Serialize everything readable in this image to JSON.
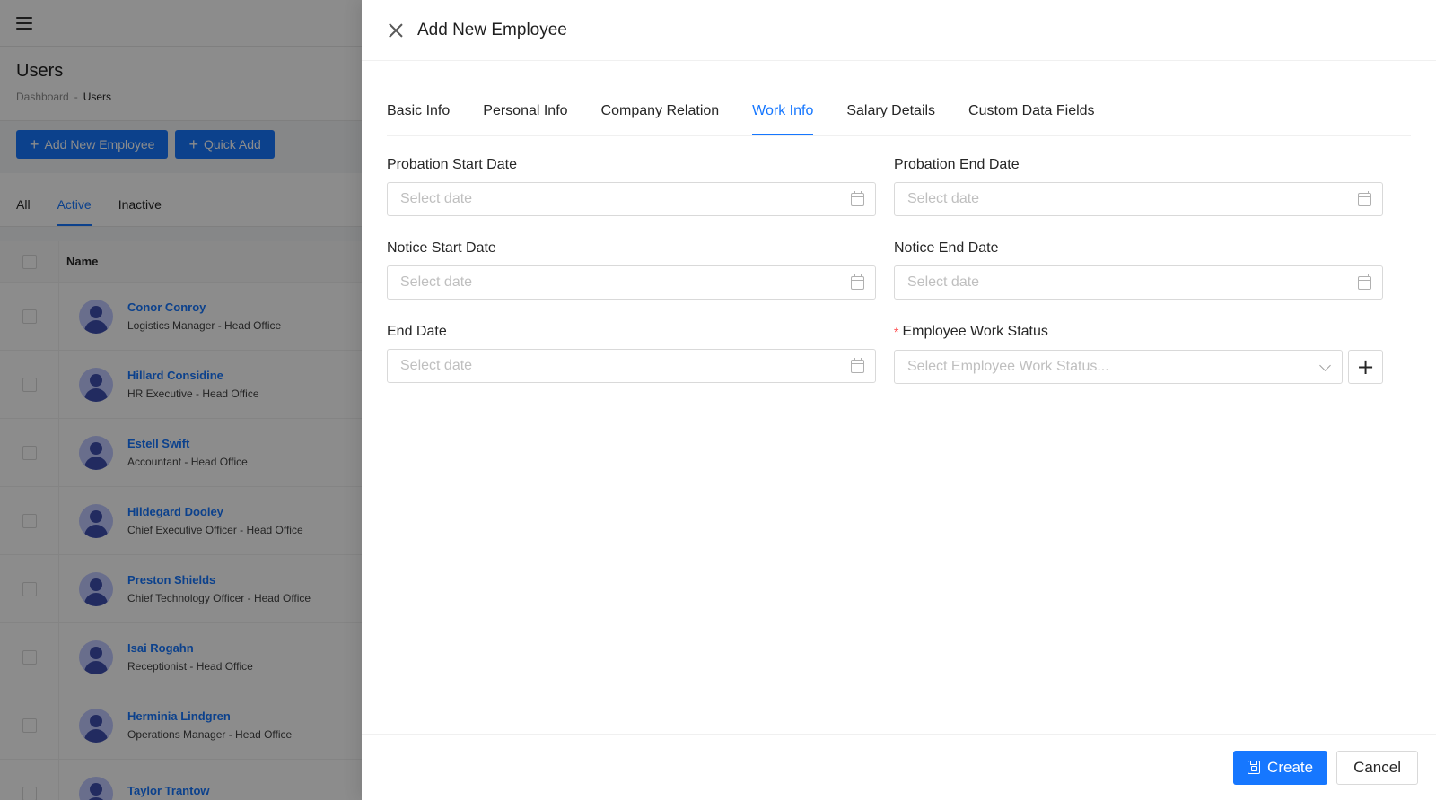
{
  "background": {
    "page_title": "Users",
    "breadcrumb": {
      "root": "Dashboard",
      "separator": "-",
      "current": "Users"
    },
    "actions": {
      "add_new_employee": "Add New Employee",
      "quick_add": "Quick Add"
    },
    "status_tabs": [
      {
        "label": "All",
        "active": false
      },
      {
        "label": "Active",
        "active": true
      },
      {
        "label": "Inactive",
        "active": false
      }
    ],
    "table": {
      "column_name": "Name",
      "rows": [
        {
          "name": "Conor Conroy",
          "role": "Logistics Manager - Head Office"
        },
        {
          "name": "Hillard Considine",
          "role": "HR Executive - Head Office"
        },
        {
          "name": "Estell Swift",
          "role": "Accountant - Head Office"
        },
        {
          "name": "Hildegard Dooley",
          "role": "Chief Executive Officer - Head Office"
        },
        {
          "name": "Preston Shields",
          "role": "Chief Technology Officer - Head Office"
        },
        {
          "name": "Isai Rogahn",
          "role": "Receptionist - Head Office"
        },
        {
          "name": "Herminia Lindgren",
          "role": "Operations Manager - Head Office"
        },
        {
          "name": "Taylor Trantow",
          "role": ""
        }
      ]
    }
  },
  "drawer": {
    "title": "Add New Employee",
    "tabs": [
      {
        "label": "Basic Info",
        "active": false
      },
      {
        "label": "Personal Info",
        "active": false
      },
      {
        "label": "Company Relation",
        "active": false
      },
      {
        "label": "Work Info",
        "active": true
      },
      {
        "label": "Salary Details",
        "active": false
      },
      {
        "label": "Custom Data Fields",
        "active": false
      }
    ],
    "fields": {
      "probation_start": {
        "label": "Probation Start Date",
        "placeholder": "Select date"
      },
      "probation_end": {
        "label": "Probation End Date",
        "placeholder": "Select date"
      },
      "notice_start": {
        "label": "Notice Start Date",
        "placeholder": "Select date"
      },
      "notice_end": {
        "label": "Notice End Date",
        "placeholder": "Select date"
      },
      "end_date": {
        "label": "End Date",
        "placeholder": "Select date"
      },
      "work_status": {
        "label": "Employee Work Status",
        "required_mark": "*",
        "placeholder": "Select Employee Work Status...",
        "add_symbol": "+"
      }
    },
    "footer": {
      "create_label": "Create",
      "cancel_label": "Cancel"
    }
  },
  "colors": {
    "primary": "#1677ff",
    "required": "#ff4d4f",
    "overlay": "rgba(0,0,0,0.45)"
  }
}
